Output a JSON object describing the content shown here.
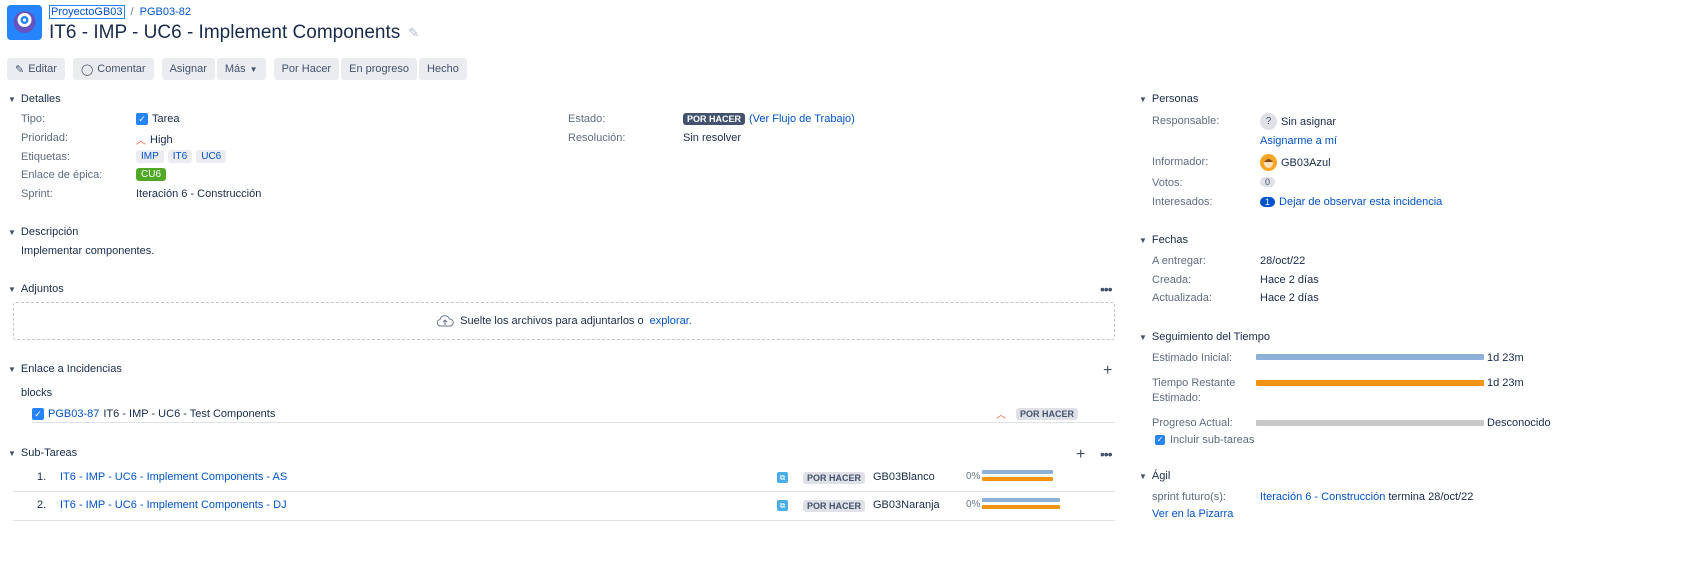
{
  "breadcrumb": {
    "project": "ProyectoGB03",
    "separator": "/",
    "key": "PGB03-82"
  },
  "issue": {
    "title": "IT6 - IMP - UC6 - Implement Components"
  },
  "toolbar": {
    "edit": "Editar",
    "comment": "Comentar",
    "assign": "Asignar",
    "more": "Más",
    "todo": "Por Hacer",
    "in_progress": "En progreso",
    "done": "Hecho"
  },
  "details": {
    "heading": "Detalles",
    "type_label": "Tipo:",
    "type_value": "Tarea",
    "priority_label": "Prioridad:",
    "priority_value": "High",
    "labels_label": "Etiquetas:",
    "labels": [
      "IMP",
      "IT6",
      "UC6"
    ],
    "epic_label": "Enlace de épica:",
    "epic_value": "CU6",
    "sprint_label": "Sprint:",
    "sprint_value": "Iteración 6 - Construcción",
    "status_label": "Estado:",
    "status_value": "POR HACER",
    "workflow_link": "(Ver Flujo de Trabajo)",
    "resolution_label": "Resolución:",
    "resolution_value": "Sin resolver"
  },
  "description": {
    "heading": "Descripción",
    "text": "Implementar componentes."
  },
  "attachments": {
    "heading": "Adjuntos",
    "drop_text": "Suelte los archivos para adjuntarlos o",
    "browse": "explorar."
  },
  "links": {
    "heading": "Enlace a Incidencias",
    "relation": "blocks",
    "items": [
      {
        "key": "PGB03-87",
        "summary": "IT6 - IMP - UC6 - Test Components",
        "status": "POR HACER"
      }
    ]
  },
  "subtasks": {
    "heading": "Sub-Tareas",
    "items": [
      {
        "num": "1.",
        "summary": "IT6 - IMP - UC6 - Implement Components - AS",
        "status": "POR HACER",
        "assignee": "GB03Blanco",
        "progress": "0%"
      },
      {
        "num": "2.",
        "summary": "IT6 - IMP - UC6 - Implement Components - DJ",
        "status": "POR HACER",
        "assignee": "GB03Naranja",
        "progress": "0%"
      }
    ]
  },
  "people": {
    "heading": "Personas",
    "assignee_label": "Responsable:",
    "assignee_value": "Sin asignar",
    "assign_me": "Asignarme a mí",
    "reporter_label": "Informador:",
    "reporter_value": "GB03Azul",
    "votes_label": "Votos:",
    "votes_value": "0",
    "watchers_label": "Interesados:",
    "watchers_value": "1",
    "watch_link": "Dejar de observar esta incidencia"
  },
  "dates": {
    "heading": "Fechas",
    "due_label": "A entregar:",
    "due_value": "28/oct/22",
    "created_label": "Creada:",
    "created_value": "Hace 2 días",
    "updated_label": "Actualizada:",
    "updated_value": "Hace 2 días"
  },
  "time": {
    "heading": "Seguimiento del Tiempo",
    "original_label": "Estimado Inicial:",
    "original_value": "1d 23m",
    "remaining_label_1": "Tiempo Restante",
    "remaining_label_2": "Estimado:",
    "remaining_value": "1d 23m",
    "logged_label": "Progreso Actual:",
    "logged_value": "Desconocido",
    "include_subtasks": "Incluir sub-tareas"
  },
  "agile": {
    "heading": "Ágil",
    "future_label": "sprint futuro(s):",
    "sprint_link": "Iteración 6 - Construcción",
    "ends_text": "termina 28/oct/22",
    "board_link": "Ver en la Pizarra"
  },
  "colors": {
    "primary": "#0052cc",
    "bar_blue": "#8eb0d8",
    "bar_orange": "#f29411",
    "bar_grey": "#c8c8c8",
    "epic_green": "#51a825"
  }
}
